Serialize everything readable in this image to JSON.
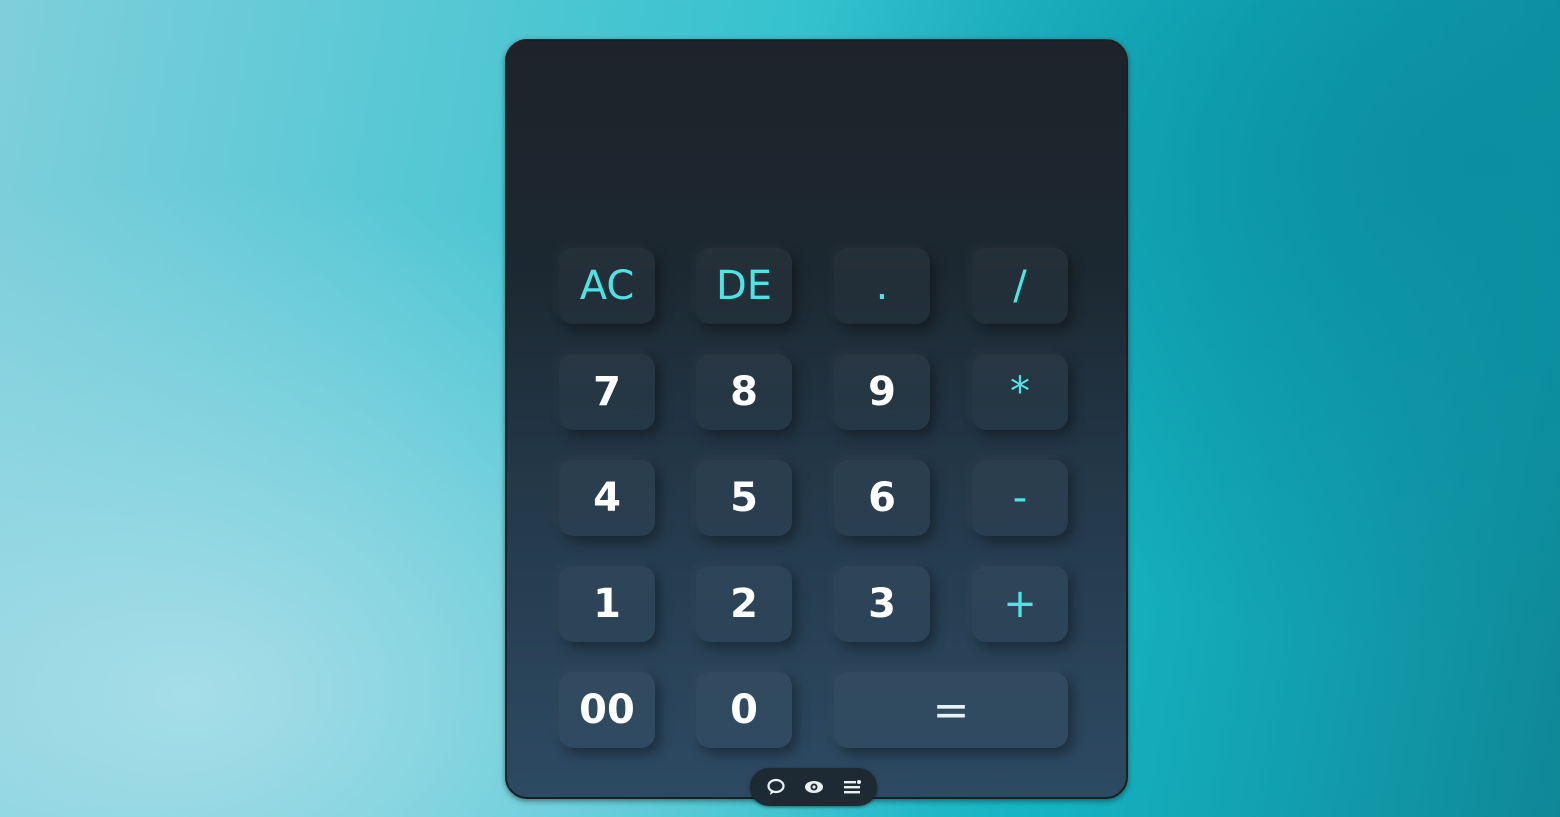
{
  "display": {
    "value": ""
  },
  "keys": {
    "ac": "AC",
    "de": "DE",
    "dot": ".",
    "divide": "/",
    "seven": "7",
    "eight": "8",
    "nine": "9",
    "multiply": "*",
    "four": "4",
    "five": "5",
    "six": "6",
    "minus": "-",
    "one": "1",
    "two": "2",
    "three": "3",
    "plus": "+",
    "double_zero": "00",
    "zero": "0",
    "equals": "="
  },
  "colors": {
    "accent": "#4ee3e6",
    "key_text": "#ffffff",
    "panel_top": "#1e232a",
    "panel_bottom": "#2d4a63"
  },
  "taskbar_pill": {
    "icons": [
      "chat-bubble-icon",
      "eye-icon",
      "list-icon"
    ]
  }
}
